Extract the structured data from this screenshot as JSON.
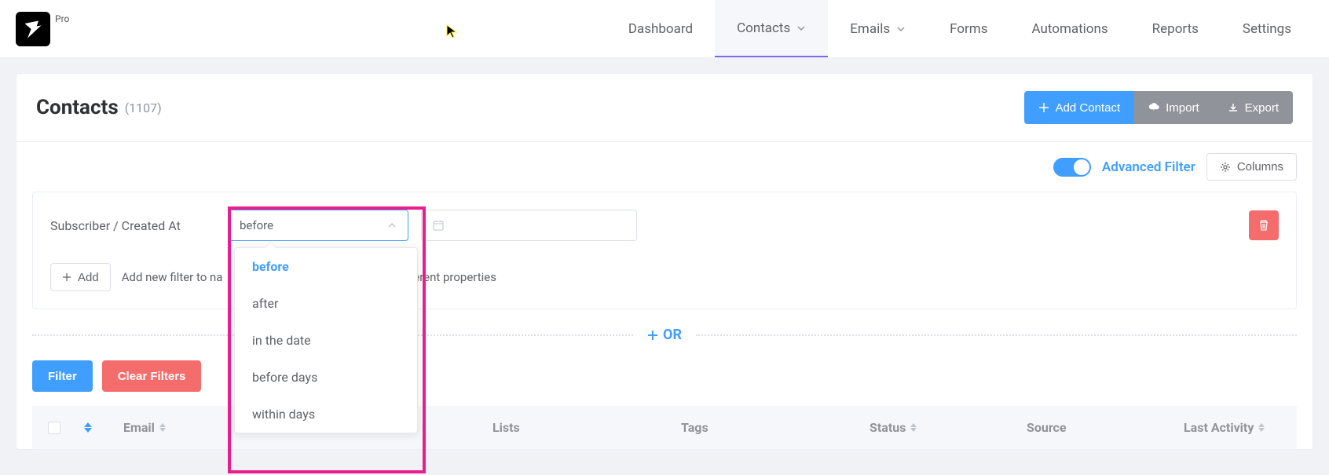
{
  "brand": {
    "badge": "Pro"
  },
  "nav": {
    "items": [
      {
        "label": "Dashboard",
        "has_dropdown": false
      },
      {
        "label": "Contacts",
        "has_dropdown": true,
        "active": true
      },
      {
        "label": "Emails",
        "has_dropdown": true
      },
      {
        "label": "Forms",
        "has_dropdown": false
      },
      {
        "label": "Automations",
        "has_dropdown": false
      },
      {
        "label": "Reports",
        "has_dropdown": false
      },
      {
        "label": "Settings",
        "has_dropdown": false
      }
    ]
  },
  "page": {
    "title": "Contacts",
    "count": "(1107)",
    "actions": {
      "add": "Add Contact",
      "import": "Import",
      "export": "Export"
    }
  },
  "toolbar": {
    "advanced_filter": "Advanced Filter",
    "columns": "Columns"
  },
  "filter": {
    "field_label": "Subscriber / Created At",
    "operator_value": "before",
    "date_value": "",
    "add_label": "Add",
    "add_desc_prefix": "Add new filter to na",
    "add_desc_suffix": "on different properties",
    "or_label": "OR",
    "filter_btn": "Filter",
    "clear_btn": "Clear Filters",
    "dropdown": {
      "options": [
        "before",
        "after",
        "in the date",
        "before days",
        "within days"
      ],
      "selected": "before"
    }
  },
  "table": {
    "columns": [
      "Email",
      "Lists",
      "Tags",
      "Status",
      "Source",
      "Last Activity"
    ]
  }
}
